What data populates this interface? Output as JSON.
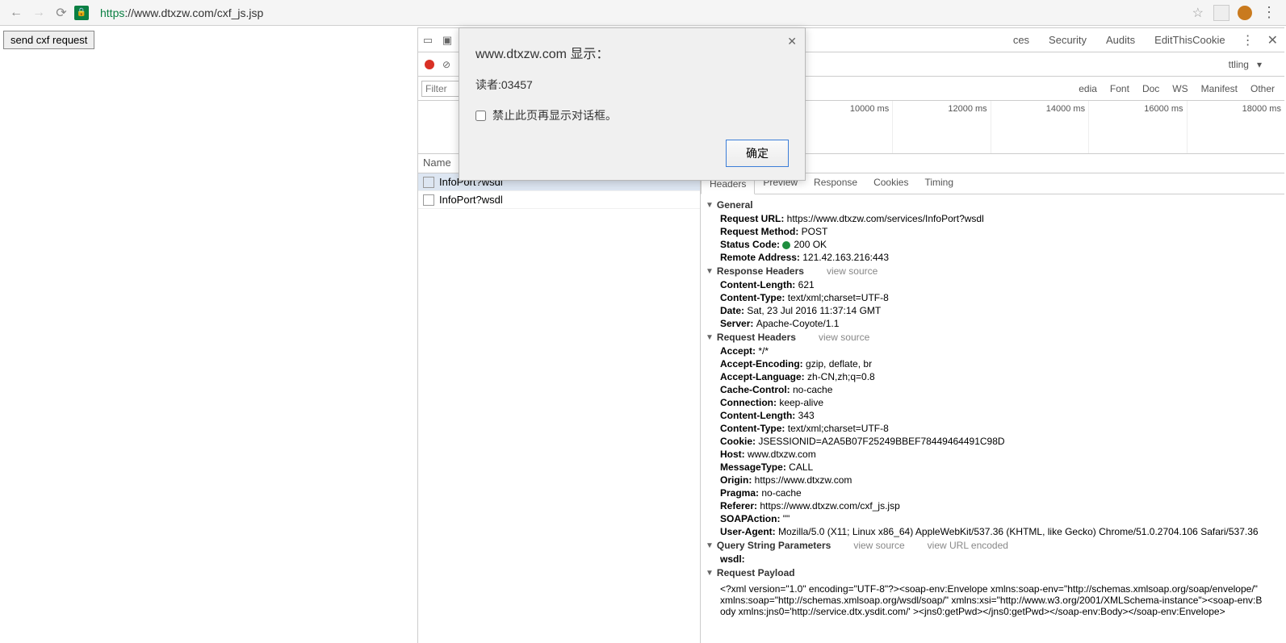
{
  "url": {
    "scheme": "https",
    "rest": "://www.dtxzw.com/cxf_js.jsp"
  },
  "page": {
    "button_label": "send cxf request"
  },
  "alert": {
    "title": "www.dtxzw.com 显示：",
    "message": "读者:03457",
    "checkbox_label": "禁止此页再显示对话框。",
    "ok_label": "确定"
  },
  "devtools": {
    "tabs_extra": [
      "ces",
      "Security",
      "Audits",
      "EditThisCookie"
    ],
    "throttling_label": "ttling",
    "filter_placeholder": "Filter",
    "filter_links": [
      "edia",
      "Font",
      "Doc",
      "WS",
      "Manifest",
      "Other"
    ],
    "timeline_ticks": [
      "10000 ms",
      "12000 ms",
      "14000 ms",
      "16000 ms",
      "18000 ms"
    ],
    "name_col": "Name",
    "requests": [
      {
        "name": "InfoPort?wsdl",
        "selected": true
      },
      {
        "name": "InfoPort?wsdl",
        "selected": false
      }
    ],
    "detail_tabs": [
      "Headers",
      "Preview",
      "Response",
      "Cookies",
      "Timing"
    ],
    "view_source": "view source",
    "view_url_encoded": "view URL encoded",
    "general": {
      "title": "General",
      "items": [
        {
          "k": "Request URL:",
          "v": "https://www.dtxzw.com/services/InfoPort?wsdl"
        },
        {
          "k": "Request Method:",
          "v": "POST"
        },
        {
          "k": "Status Code:",
          "v": "200 OK",
          "status": true
        },
        {
          "k": "Remote Address:",
          "v": "121.42.163.216:443"
        }
      ]
    },
    "response_headers": {
      "title": "Response Headers",
      "items": [
        {
          "k": "Content-Length:",
          "v": "621"
        },
        {
          "k": "Content-Type:",
          "v": "text/xml;charset=UTF-8"
        },
        {
          "k": "Date:",
          "v": "Sat, 23 Jul 2016 11:37:14 GMT"
        },
        {
          "k": "Server:",
          "v": "Apache-Coyote/1.1"
        }
      ]
    },
    "request_headers": {
      "title": "Request Headers",
      "items": [
        {
          "k": "Accept:",
          "v": "*/*"
        },
        {
          "k": "Accept-Encoding:",
          "v": "gzip, deflate, br"
        },
        {
          "k": "Accept-Language:",
          "v": "zh-CN,zh;q=0.8"
        },
        {
          "k": "Cache-Control:",
          "v": "no-cache"
        },
        {
          "k": "Connection:",
          "v": "keep-alive"
        },
        {
          "k": "Content-Length:",
          "v": "343"
        },
        {
          "k": "Content-Type:",
          "v": "text/xml;charset=UTF-8"
        },
        {
          "k": "Cookie:",
          "v": "JSESSIONID=A2A5B07F25249BBEF78449464491C98D"
        },
        {
          "k": "Host:",
          "v": "www.dtxzw.com"
        },
        {
          "k": "MessageType:",
          "v": "CALL"
        },
        {
          "k": "Origin:",
          "v": "https://www.dtxzw.com"
        },
        {
          "k": "Pragma:",
          "v": "no-cache"
        },
        {
          "k": "Referer:",
          "v": "https://www.dtxzw.com/cxf_js.jsp"
        },
        {
          "k": "SOAPAction:",
          "v": "\"\""
        },
        {
          "k": "User-Agent:",
          "v": "Mozilla/5.0 (X11; Linux x86_64) AppleWebKit/537.36 (KHTML, like Gecko) Chrome/51.0.2704.106 Safari/537.36"
        }
      ]
    },
    "query_string": {
      "title": "Query String Parameters",
      "items": [
        {
          "k": "wsdl:",
          "v": ""
        }
      ]
    },
    "request_payload": {
      "title": "Request Payload",
      "body": "<?xml version=\"1.0\" encoding=\"UTF-8\"?><soap-env:Envelope xmlns:soap-env=\"http://schemas.xmlsoap.org/soap/envelope/\" xmlns:soap=\"http://schemas.xmlsoap.org/wsdl/soap/\" xmlns:xsi=\"http://www.w3.org/2001/XMLSchema-instance\"><soap-env:Body xmlns:jns0='http://service.dtx.ysdit.com/' ><jns0:getPwd></jns0:getPwd></soap-env:Body></soap-env:Envelope>"
    }
  }
}
